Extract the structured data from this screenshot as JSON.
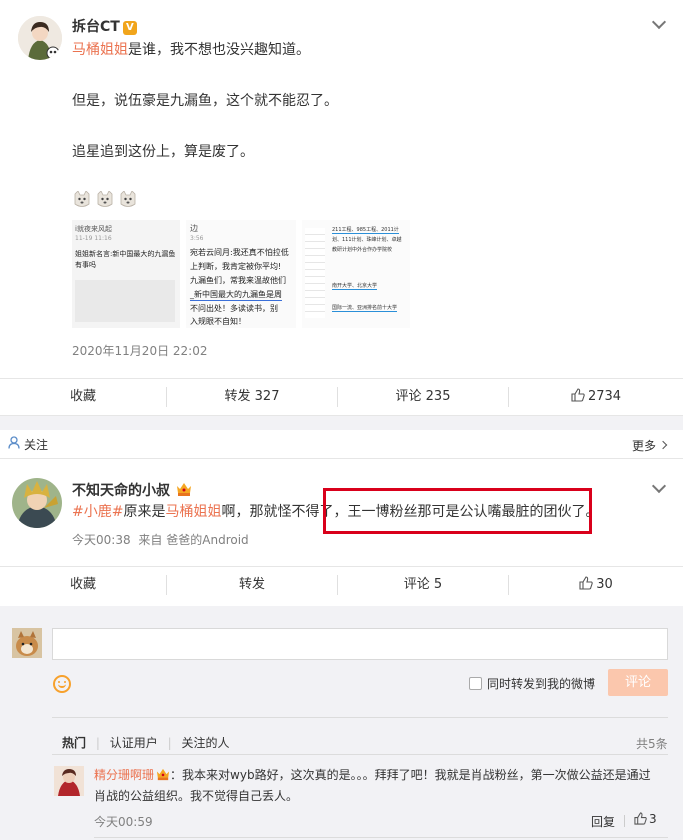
{
  "post1": {
    "username": "拆台CT",
    "verified_badge": "V",
    "line1_mention": "马桶姐姐",
    "line1_rest": "是谁，我不想也没兴趣知道。",
    "line2": "但是，说伍豪是九漏鱼，这个就不能忍了。",
    "line3": "追星追到这份上，算是废了。",
    "emoji_row": [
      "doge-face-icon",
      "doge-face-icon",
      "doge-face-icon"
    ],
    "thumb1": {
      "title": "i就夜来风起",
      "time": "11-19 11:16",
      "lines": [
        "姐姐新名言:新中国最大的九漏鱼",
        "有事吗"
      ]
    },
    "thumb2": {
      "title": "边",
      "time": "3:56",
      "lines": [
        "宛若云间月:我还真不怕拉低",
        "上判断，我肯定被你平均!",
        "九漏鱼们，常我来温故他们",
        "_新中国最大的九漏鱼是周",
        "不问出处！多读读书，别",
        "入规眼不自知！"
      ]
    },
    "thumb3": {
      "lines": [
        "211工程、985工程、2011计",
        "划、111计划、珠峰计划、卓越",
        "教研计划中外合作办学院校",
        "南开大学、北京大学",
        "国际一流、亚洲排名前十大学"
      ]
    },
    "timestamp": "2020年11月20日 22:02",
    "actions": {
      "favorite": "收藏",
      "repost": "转发 327",
      "comment": "评论 235",
      "like": "2734"
    }
  },
  "follow": {
    "label": "关注",
    "more": "更多"
  },
  "post2": {
    "username": "不知天命的小叔",
    "topic": "#小鹿#",
    "text_a": "原来是",
    "mention": "马桶姐姐",
    "text_b": "啊，那就怪不得了，王一博粉丝那可是公认嘴最脏的团伙了。",
    "time": "今天00:38",
    "source_prefix": "来自",
    "source": "爸爸的Android",
    "actions": {
      "favorite": "收藏",
      "repost": "转发",
      "comment": "评论 5",
      "like": "30"
    }
  },
  "comment_box": {
    "repost_checkbox_label": "同时转发到我的微博",
    "submit": "评论"
  },
  "comment_tabs": {
    "tabs": [
      "热门",
      "认证用户",
      "关注的人"
    ],
    "total": "共5条"
  },
  "comment1": {
    "username": "精分珊啊珊",
    "colon": "：",
    "text1": "我本来对wyb路好，这次真的是。。。拜拜了吧！我就是肖战粉丝，第一次做公益还是通过",
    "text2": "肖战的公益组织。我不觉得自己丢人。",
    "time": "今天00:59",
    "reply": "回复",
    "likes": "3"
  },
  "colors": {
    "accent": "#eb7350",
    "highlight_box": "#d9001b",
    "submit_button": "#fbc7ad",
    "background_gray": "#f2f2f5"
  }
}
